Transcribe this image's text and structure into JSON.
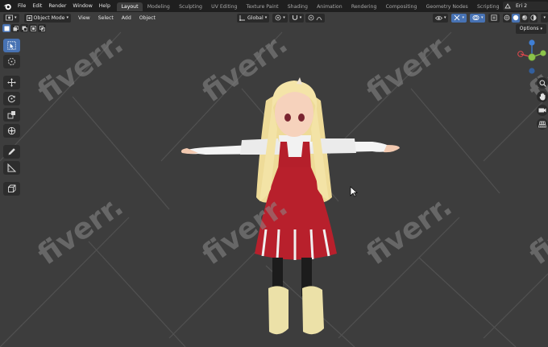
{
  "menu": {
    "items": [
      "File",
      "Edit",
      "Render",
      "Window",
      "Help"
    ]
  },
  "workspaces": {
    "tabs": [
      "Layout",
      "Modeling",
      "Sculpting",
      "UV Editing",
      "Texture Paint",
      "Shading",
      "Animation",
      "Rendering",
      "Compositing",
      "Geometry Nodes",
      "Scripting"
    ],
    "active": "Layout",
    "add_label": "+"
  },
  "view_layer": "Eri 2",
  "viewport_header": {
    "mode": "Object Mode",
    "menus": [
      "View",
      "Select",
      "Add",
      "Object"
    ],
    "orientation": "Global",
    "options_label": "Options"
  },
  "watermark": "fiverr.",
  "colors": {
    "accent": "#4772b3",
    "background": "#3d3d3d",
    "topbar": "#1f1f1f",
    "axis_x": "#e5484d",
    "axis_y": "#8bc34a",
    "axis_z": "#3f7fd6",
    "dress_red": "#b51f2b",
    "hair_blonde": "#f1df9e"
  }
}
